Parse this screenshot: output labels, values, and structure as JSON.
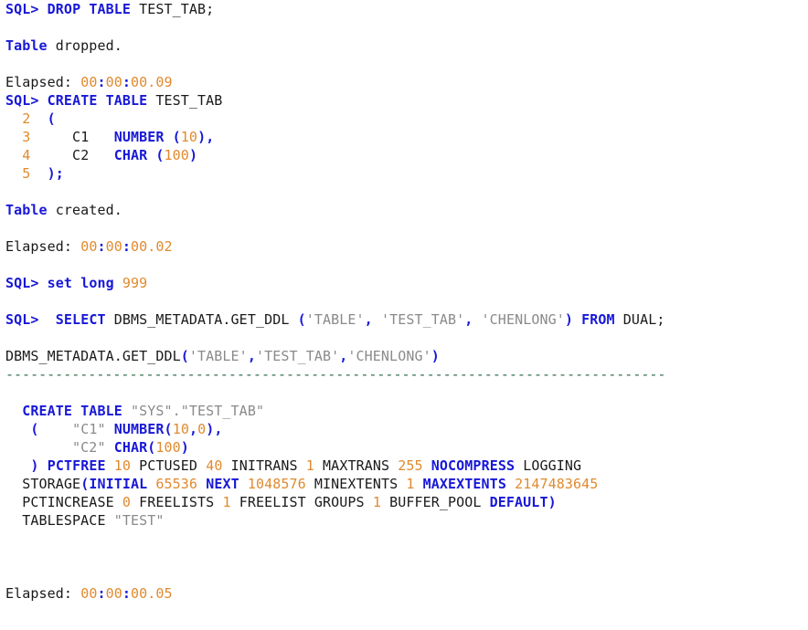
{
  "terminal": {
    "app": "SQL*Plus",
    "prompt": "SQL>",
    "background_color": "#ffffff",
    "keyword_color": "#1818d8",
    "number_color": "#e08a2e",
    "string_color": "#8a8a8a",
    "plain_color": "#1a1a1a",
    "separator_color": "#2e6b4a"
  },
  "lines": [
    {
      "id": "l01",
      "name": "command-drop-table",
      "tokens": [
        {
          "t": "SQL>",
          "c": "kw"
        },
        {
          "t": " ",
          "c": "plain"
        },
        {
          "t": "DROP TABLE",
          "c": "kw"
        },
        {
          "t": " TEST_TAB;",
          "c": "plain"
        }
      ]
    },
    {
      "id": "l02",
      "name": "blank-line",
      "tokens": []
    },
    {
      "id": "l03",
      "name": "result-table-dropped",
      "tokens": [
        {
          "t": "Table",
          "c": "kw"
        },
        {
          "t": " dropped.",
          "c": "plain"
        }
      ]
    },
    {
      "id": "l04",
      "name": "blank-line",
      "tokens": []
    },
    {
      "id": "l05",
      "name": "elapsed-drop",
      "tokens": [
        {
          "t": "Elapsed: ",
          "c": "plain"
        },
        {
          "t": "00",
          "c": "num"
        },
        {
          "t": ":",
          "c": "kw"
        },
        {
          "t": "00",
          "c": "num"
        },
        {
          "t": ":",
          "c": "kw"
        },
        {
          "t": "00.09",
          "c": "num"
        }
      ]
    },
    {
      "id": "l06",
      "name": "command-create-table",
      "tokens": [
        {
          "t": "SQL>",
          "c": "kw"
        },
        {
          "t": " ",
          "c": "plain"
        },
        {
          "t": "CREATE TABLE",
          "c": "kw"
        },
        {
          "t": " TEST_TAB",
          "c": "plain"
        }
      ]
    },
    {
      "id": "l07",
      "name": "continuation-line-2",
      "tokens": [
        {
          "t": "  2",
          "c": "num"
        },
        {
          "t": "  ",
          "c": "plain"
        },
        {
          "t": "(",
          "c": "kw"
        }
      ]
    },
    {
      "id": "l08",
      "name": "continuation-line-3",
      "tokens": [
        {
          "t": "  3",
          "c": "num"
        },
        {
          "t": "     C1   ",
          "c": "plain"
        },
        {
          "t": "NUMBER",
          "c": "kw"
        },
        {
          "t": " ",
          "c": "plain"
        },
        {
          "t": "(",
          "c": "kw"
        },
        {
          "t": "10",
          "c": "num"
        },
        {
          "t": ")",
          "c": "kw"
        },
        {
          "t": ",",
          "c": "kw"
        }
      ]
    },
    {
      "id": "l09",
      "name": "continuation-line-4",
      "tokens": [
        {
          "t": "  4",
          "c": "num"
        },
        {
          "t": "     C2   ",
          "c": "plain"
        },
        {
          "t": "CHAR",
          "c": "kw"
        },
        {
          "t": " ",
          "c": "plain"
        },
        {
          "t": "(",
          "c": "kw"
        },
        {
          "t": "100",
          "c": "num"
        },
        {
          "t": ")",
          "c": "kw"
        }
      ]
    },
    {
      "id": "l10",
      "name": "continuation-line-5",
      "tokens": [
        {
          "t": "  5",
          "c": "num"
        },
        {
          "t": "  ",
          "c": "plain"
        },
        {
          "t": ");",
          "c": "kw"
        }
      ]
    },
    {
      "id": "l11",
      "name": "blank-line",
      "tokens": []
    },
    {
      "id": "l12",
      "name": "result-table-created",
      "tokens": [
        {
          "t": "Table",
          "c": "kw"
        },
        {
          "t": " created.",
          "c": "plain"
        }
      ]
    },
    {
      "id": "l13",
      "name": "blank-line",
      "tokens": []
    },
    {
      "id": "l14",
      "name": "elapsed-create",
      "tokens": [
        {
          "t": "Elapsed: ",
          "c": "plain"
        },
        {
          "t": "00",
          "c": "num"
        },
        {
          "t": ":",
          "c": "kw"
        },
        {
          "t": "00",
          "c": "num"
        },
        {
          "t": ":",
          "c": "kw"
        },
        {
          "t": "00.02",
          "c": "num"
        }
      ]
    },
    {
      "id": "l15",
      "name": "blank-line",
      "tokens": []
    },
    {
      "id": "l16",
      "name": "command-set-long",
      "tokens": [
        {
          "t": "SQL>",
          "c": "kw"
        },
        {
          "t": " ",
          "c": "plain"
        },
        {
          "t": "set long",
          "c": "kw"
        },
        {
          "t": " ",
          "c": "plain"
        },
        {
          "t": "999",
          "c": "num"
        }
      ]
    },
    {
      "id": "l17",
      "name": "blank-line",
      "tokens": []
    },
    {
      "id": "l18",
      "name": "command-select-get-ddl",
      "tokens": [
        {
          "t": "SQL>",
          "c": "kw"
        },
        {
          "t": "  ",
          "c": "plain"
        },
        {
          "t": "SELECT",
          "c": "kw"
        },
        {
          "t": " DBMS_METADATA.GET_DDL ",
          "c": "plain"
        },
        {
          "t": "(",
          "c": "kw"
        },
        {
          "t": "'TABLE'",
          "c": "str"
        },
        {
          "t": ",",
          "c": "kw"
        },
        {
          "t": " ",
          "c": "plain"
        },
        {
          "t": "'TEST_TAB'",
          "c": "str"
        },
        {
          "t": ",",
          "c": "kw"
        },
        {
          "t": " ",
          "c": "plain"
        },
        {
          "t": "'CHENLONG'",
          "c": "str"
        },
        {
          "t": ")",
          "c": "kw"
        },
        {
          "t": " ",
          "c": "plain"
        },
        {
          "t": "FROM",
          "c": "kw"
        },
        {
          "t": " DUAL;",
          "c": "plain"
        }
      ]
    },
    {
      "id": "l19",
      "name": "blank-line",
      "tokens": []
    },
    {
      "id": "l20",
      "name": "column-header-get-ddl",
      "tokens": [
        {
          "t": "DBMS_METADATA.GET_DDL",
          "c": "plain"
        },
        {
          "t": "(",
          "c": "kw"
        },
        {
          "t": "'TABLE'",
          "c": "str"
        },
        {
          "t": ",",
          "c": "kw"
        },
        {
          "t": "'TEST_TAB'",
          "c": "str"
        },
        {
          "t": ",",
          "c": "kw"
        },
        {
          "t": "'CHENLONG'",
          "c": "str"
        },
        {
          "t": ")",
          "c": "kw"
        }
      ]
    },
    {
      "id": "l21",
      "name": "column-separator-rule",
      "tokens": [
        {
          "t": "--------------------------------------------------------------------------------",
          "c": "sep"
        }
      ]
    },
    {
      "id": "l22",
      "name": "blank-line",
      "tokens": []
    },
    {
      "id": "l23",
      "name": "ddl-create-table",
      "tokens": [
        {
          "t": "  ",
          "c": "plain"
        },
        {
          "t": "CREATE TABLE",
          "c": "kw"
        },
        {
          "t": " ",
          "c": "plain"
        },
        {
          "t": "\"SYS\".\"TEST_TAB\"",
          "c": "str"
        }
      ]
    },
    {
      "id": "l24",
      "name": "ddl-column-c1",
      "tokens": [
        {
          "t": "   ",
          "c": "plain"
        },
        {
          "t": "(",
          "c": "kw"
        },
        {
          "t": "    ",
          "c": "plain"
        },
        {
          "t": "\"C1\"",
          "c": "str"
        },
        {
          "t": " ",
          "c": "plain"
        },
        {
          "t": "NUMBER",
          "c": "kw"
        },
        {
          "t": "(",
          "c": "kw"
        },
        {
          "t": "10",
          "c": "num"
        },
        {
          "t": ",",
          "c": "kw"
        },
        {
          "t": "0",
          "c": "num"
        },
        {
          "t": ")",
          "c": "kw"
        },
        {
          "t": ",",
          "c": "kw"
        }
      ]
    },
    {
      "id": "l25",
      "name": "ddl-column-c2",
      "tokens": [
        {
          "t": "        ",
          "c": "plain"
        },
        {
          "t": "\"C2\"",
          "c": "str"
        },
        {
          "t": " ",
          "c": "plain"
        },
        {
          "t": "CHAR",
          "c": "kw"
        },
        {
          "t": "(",
          "c": "kw"
        },
        {
          "t": "100",
          "c": "num"
        },
        {
          "t": ")",
          "c": "kw"
        }
      ]
    },
    {
      "id": "l26",
      "name": "ddl-storage-attrs-line1",
      "tokens": [
        {
          "t": "   ",
          "c": "plain"
        },
        {
          "t": ")",
          "c": "kw"
        },
        {
          "t": " ",
          "c": "plain"
        },
        {
          "t": "PCTFREE",
          "c": "kw"
        },
        {
          "t": " ",
          "c": "plain"
        },
        {
          "t": "10",
          "c": "num"
        },
        {
          "t": " PCTUSED ",
          "c": "plain"
        },
        {
          "t": "40",
          "c": "num"
        },
        {
          "t": " INITRANS ",
          "c": "plain"
        },
        {
          "t": "1",
          "c": "num"
        },
        {
          "t": " MAXTRANS ",
          "c": "plain"
        },
        {
          "t": "255",
          "c": "num"
        },
        {
          "t": " ",
          "c": "plain"
        },
        {
          "t": "NOCOMPRESS",
          "c": "kw"
        },
        {
          "t": " LOGGING",
          "c": "plain"
        }
      ]
    },
    {
      "id": "l27",
      "name": "ddl-storage-attrs-line2",
      "tokens": [
        {
          "t": "  STORAGE",
          "c": "plain"
        },
        {
          "t": "(",
          "c": "kw"
        },
        {
          "t": "INITIAL",
          "c": "kw"
        },
        {
          "t": " ",
          "c": "plain"
        },
        {
          "t": "65536",
          "c": "num"
        },
        {
          "t": " ",
          "c": "plain"
        },
        {
          "t": "NEXT",
          "c": "kw"
        },
        {
          "t": " ",
          "c": "plain"
        },
        {
          "t": "1048576",
          "c": "num"
        },
        {
          "t": " MINEXTENTS ",
          "c": "plain"
        },
        {
          "t": "1",
          "c": "num"
        },
        {
          "t": " ",
          "c": "plain"
        },
        {
          "t": "MAXEXTENTS",
          "c": "kw"
        },
        {
          "t": " ",
          "c": "plain"
        },
        {
          "t": "2147483645",
          "c": "num"
        }
      ]
    },
    {
      "id": "l28",
      "name": "ddl-storage-attrs-line3",
      "tokens": [
        {
          "t": "  PCTINCREASE ",
          "c": "plain"
        },
        {
          "t": "0",
          "c": "num"
        },
        {
          "t": " FREELISTS ",
          "c": "plain"
        },
        {
          "t": "1",
          "c": "num"
        },
        {
          "t": " FREELIST GROUPS ",
          "c": "plain"
        },
        {
          "t": "1",
          "c": "num"
        },
        {
          "t": " BUFFER_POOL ",
          "c": "plain"
        },
        {
          "t": "DEFAULT",
          "c": "kw"
        },
        {
          "t": ")",
          "c": "kw"
        }
      ]
    },
    {
      "id": "l29",
      "name": "ddl-tablespace",
      "tokens": [
        {
          "t": "  TABLESPACE ",
          "c": "plain"
        },
        {
          "t": "\"TEST\"",
          "c": "str"
        }
      ]
    },
    {
      "id": "l30",
      "name": "blank-line",
      "tokens": []
    },
    {
      "id": "l31",
      "name": "blank-line",
      "tokens": []
    },
    {
      "id": "l32",
      "name": "blank-line",
      "tokens": []
    },
    {
      "id": "l33",
      "name": "elapsed-select",
      "tokens": [
        {
          "t": "Elapsed: ",
          "c": "plain"
        },
        {
          "t": "00",
          "c": "num"
        },
        {
          "t": ":",
          "c": "kw"
        },
        {
          "t": "00",
          "c": "num"
        },
        {
          "t": ":",
          "c": "kw"
        },
        {
          "t": "00.05",
          "c": "num"
        }
      ]
    }
  ]
}
